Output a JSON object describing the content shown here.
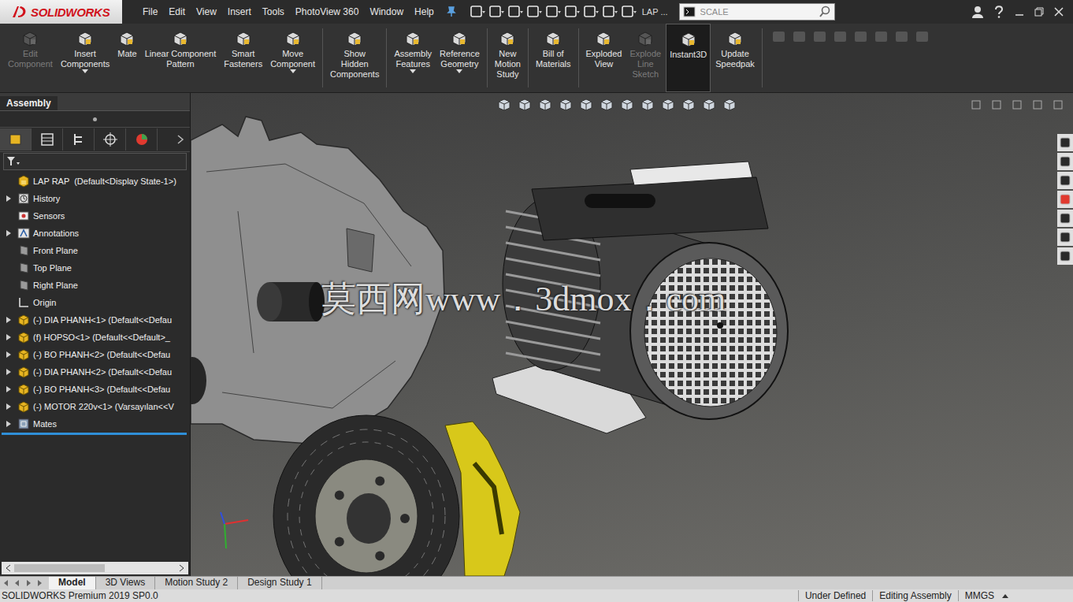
{
  "app": {
    "logo": "SOLIDWORKS"
  },
  "menu": [
    "File",
    "Edit",
    "View",
    "Insert",
    "Tools",
    "PhotoView 360",
    "Window",
    "Help"
  ],
  "document": {
    "title": "LAP ..."
  },
  "search": {
    "value": "SCALE"
  },
  "ribbon": [
    {
      "lines": [
        "Edit",
        "Component"
      ],
      "disabled": true,
      "selected": false,
      "dropdown": false,
      "group": 1
    },
    {
      "lines": [
        "Insert",
        "Components"
      ],
      "disabled": false,
      "selected": false,
      "dropdown": true,
      "group": 1
    },
    {
      "lines": [
        "Mate"
      ],
      "disabled": false,
      "selected": false,
      "dropdown": false,
      "group": 1
    },
    {
      "lines": [
        "Linear Component",
        "Pattern"
      ],
      "disabled": false,
      "selected": false,
      "dropdown": false,
      "group": 1
    },
    {
      "lines": [
        "Smart",
        "Fasteners"
      ],
      "disabled": false,
      "selected": false,
      "dropdown": false,
      "group": 1
    },
    {
      "lines": [
        "Move",
        "Component"
      ],
      "disabled": false,
      "selected": false,
      "dropdown": true,
      "group": 1
    },
    {
      "lines": [
        "Show",
        "Hidden",
        "Components"
      ],
      "disabled": false,
      "selected": false,
      "dropdown": false,
      "group": 2
    },
    {
      "lines": [
        "Assembly",
        "Features"
      ],
      "disabled": false,
      "selected": false,
      "dropdown": true,
      "group": 3
    },
    {
      "lines": [
        "Reference",
        "Geometry"
      ],
      "disabled": false,
      "selected": false,
      "dropdown": true,
      "group": 3
    },
    {
      "lines": [
        "New",
        "Motion",
        "Study"
      ],
      "disabled": false,
      "selected": false,
      "dropdown": false,
      "group": 4
    },
    {
      "lines": [
        "Bill of",
        "Materials"
      ],
      "disabled": false,
      "selected": false,
      "dropdown": false,
      "group": 5
    },
    {
      "lines": [
        "Exploded",
        "View"
      ],
      "disabled": false,
      "selected": false,
      "dropdown": false,
      "group": 6
    },
    {
      "lines": [
        "Explode",
        "Line",
        "Sketch"
      ],
      "disabled": true,
      "selected": false,
      "dropdown": false,
      "group": 6
    },
    {
      "lines": [
        "Instant3D"
      ],
      "disabled": false,
      "selected": true,
      "dropdown": false,
      "group": 6
    },
    {
      "lines": [
        "Update",
        "Speedpak"
      ],
      "disabled": false,
      "selected": false,
      "dropdown": false,
      "group": 6
    }
  ],
  "panel": {
    "tab": {
      "label": "Assembly",
      "selected": true
    },
    "view_tabs": [
      {
        "selected": true
      },
      {
        "selected": false
      },
      {
        "selected": false
      },
      {
        "selected": false
      },
      {
        "selected": false
      }
    ]
  },
  "tree": {
    "root": "LAP RAP  (Default<Display State-1>)",
    "items": [
      {
        "label": "History",
        "kind": "history",
        "expandable": true
      },
      {
        "label": "Sensors",
        "kind": "sensor",
        "expandable": false
      },
      {
        "label": "Annotations",
        "kind": "annotation",
        "expandable": true
      },
      {
        "label": "Front Plane",
        "kind": "plane",
        "expandable": false
      },
      {
        "label": "Top Plane",
        "kind": "plane",
        "expandable": false
      },
      {
        "label": "Right Plane",
        "kind": "plane",
        "expandable": false
      },
      {
        "label": "Origin",
        "kind": "origin",
        "expandable": false
      },
      {
        "label": "(-) DIA PHANH<1> (Default<<Defau",
        "kind": "part",
        "expandable": true
      },
      {
        "label": "(f) HOPSO<1> (Default<<Default>_",
        "kind": "part",
        "expandable": true
      },
      {
        "label": "(-) BO PHANH<2> (Default<<Defau",
        "kind": "part",
        "expandable": true
      },
      {
        "label": "(-) DIA PHANH<2> (Default<<Defau",
        "kind": "part",
        "expandable": true
      },
      {
        "label": "(-) BO PHANH<3> (Default<<Defau",
        "kind": "part",
        "expandable": true
      },
      {
        "label": "(-) MOTOR 220v<1> (Varsayılan<<V",
        "kind": "part",
        "expandable": true
      },
      {
        "label": "Mates",
        "kind": "mates",
        "expandable": true
      }
    ]
  },
  "watermark": "莫西网www．3dmox．com",
  "bottom_tabs": [
    {
      "label": "Model",
      "selected": true
    },
    {
      "label": "3D Views",
      "selected": false
    },
    {
      "label": "Motion Study 2",
      "selected": false
    },
    {
      "label": "Design Study 1",
      "selected": false
    }
  ],
  "status_bar": {
    "product": "SOLIDWORKS Premium 2019 SP0.0",
    "fields": [
      "Under Defined",
      "Editing Assembly",
      "MMGS"
    ]
  }
}
